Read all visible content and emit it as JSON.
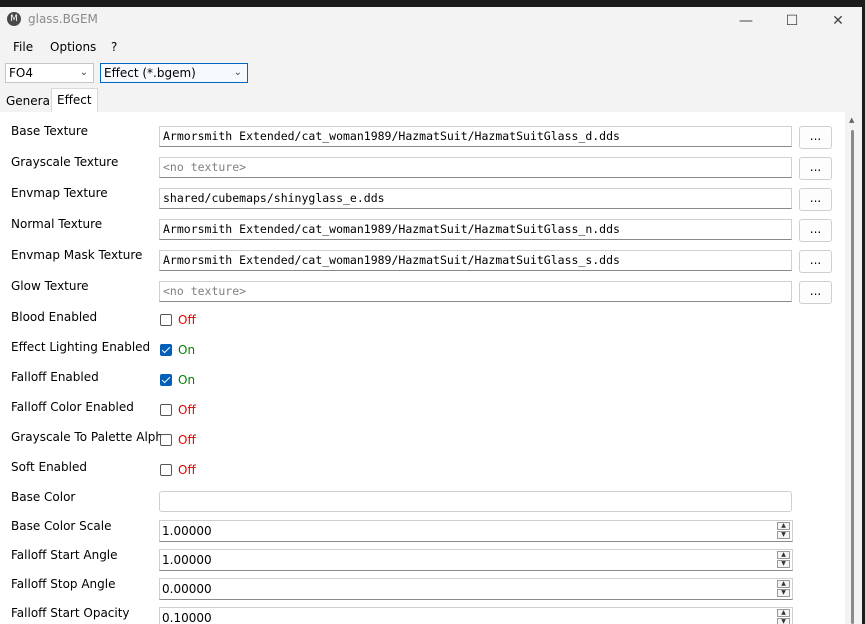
{
  "window": {
    "title": "glass.BGEM",
    "app_icon": "M"
  },
  "menu": [
    "File",
    "Options",
    "?"
  ],
  "toolbar": {
    "game": "FO4",
    "file_type": "Effect (*.bgem)"
  },
  "tabs": [
    "General",
    "Effect"
  ],
  "browse_label": "...",
  "textures": [
    {
      "label": "Base Texture",
      "value": "Armorsmith Extended/cat_woman1989/HazmatSuit/HazmatSuitGlass_d.dds"
    },
    {
      "label": "Grayscale Texture",
      "placeholder": "<no texture>"
    },
    {
      "label": "Envmap Texture",
      "value": "shared/cubemaps/shinyglass_e.dds"
    },
    {
      "label": "Normal Texture",
      "value": "Armorsmith Extended/cat_woman1989/HazmatSuit/HazmatSuitGlass_n.dds"
    },
    {
      "label": "Envmap Mask Texture",
      "value": "Armorsmith Extended/cat_woman1989/HazmatSuit/HazmatSuitGlass_s.dds"
    },
    {
      "label": "Glow Texture",
      "placeholder": "<no texture>"
    }
  ],
  "toggles": [
    {
      "label": "Blood Enabled",
      "state": "Off"
    },
    {
      "label": "Effect Lighting Enabled",
      "state": "On"
    },
    {
      "label": "Falloff Enabled",
      "state": "On"
    },
    {
      "label": "Falloff Color Enabled",
      "state": "Off"
    },
    {
      "label": "Grayscale To Palette Alpha",
      "state": "Off"
    },
    {
      "label": "Soft Enabled",
      "state": "Off"
    }
  ],
  "base_color": {
    "label": "Base Color"
  },
  "numbers": [
    {
      "label": "Base Color Scale",
      "value": "1.00000"
    },
    {
      "label": "Falloff Start Angle",
      "value": "1.00000"
    },
    {
      "label": "Falloff Stop Angle",
      "value": "0.00000"
    },
    {
      "label": "Falloff Start Opacity",
      "value": "0.10000"
    }
  ],
  "colors": {
    "on": "#008000",
    "off": "#e00000",
    "accent": "#005fb8"
  }
}
